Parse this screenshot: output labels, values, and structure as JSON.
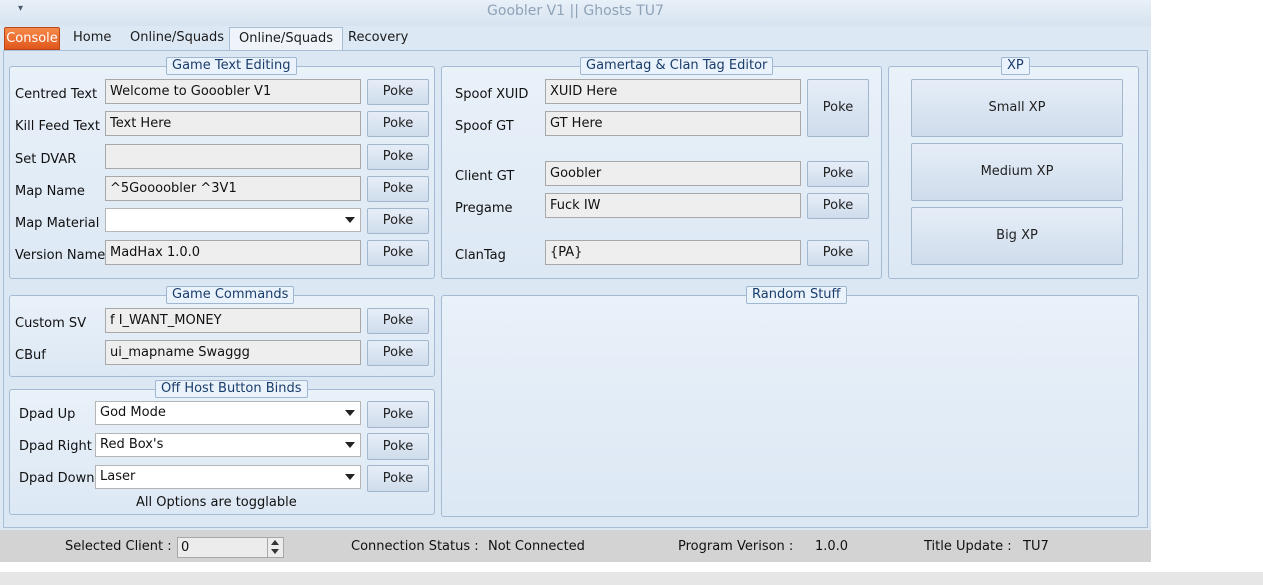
{
  "window": {
    "title": "Goobler V1 || Ghosts TU7",
    "quick_access": "▾"
  },
  "tabs": [
    {
      "label": "Console"
    },
    {
      "label": "Home"
    },
    {
      "label": "Online/Squads"
    },
    {
      "label": "Online/Squads"
    },
    {
      "label": "Recovery"
    }
  ],
  "game_text": {
    "title": "Game Text Editing",
    "rows": [
      {
        "label": "Centred Text",
        "value": "Welcome to Gooobler V1",
        "button": "Poke"
      },
      {
        "label": "Kill Feed Text",
        "value": "Text Here",
        "button": "Poke"
      },
      {
        "label": "Set DVAR",
        "value": "",
        "button": "Poke"
      },
      {
        "label": "Map Name",
        "value": "^5Goooobler ^3V1",
        "button": "Poke"
      },
      {
        "label": "Map Material",
        "value": "",
        "button": "Poke"
      },
      {
        "label": "Version Name",
        "value": "MadHax 1.0.0",
        "button": "Poke"
      }
    ]
  },
  "gamertag": {
    "title": "Gamertag & Clan Tag Editor",
    "spoof_xuid": {
      "label": "Spoof XUID",
      "value": "XUID Here"
    },
    "spoof_gt": {
      "label": "Spoof GT",
      "value": "GT Here"
    },
    "spoof_button": "Poke",
    "client_gt": {
      "label": "Client GT",
      "value": "Goobler",
      "button": "Poke"
    },
    "pregame": {
      "label": "Pregame",
      "value": "Fuck IW",
      "button": "Poke"
    },
    "clantag": {
      "label": "ClanTag",
      "value": "{PA}",
      "button": "Poke"
    }
  },
  "xp": {
    "title": "XP",
    "small": "Small XP",
    "medium": "Medium XP",
    "big": "Big XP"
  },
  "game_commands": {
    "title": "Game Commands",
    "custom_sv": {
      "label": "Custom SV",
      "value": "f I_WANT_MONEY",
      "button": "Poke"
    },
    "cbuf": {
      "label": "CBuf",
      "value": "ui_mapname Swaggg",
      "button": "Poke"
    }
  },
  "binds": {
    "title": "Off Host Button Binds",
    "rows": [
      {
        "label": "Dpad Up",
        "value": "God Mode",
        "button": "Poke"
      },
      {
        "label": "Dpad Right",
        "value": "Red Box's",
        "button": "Poke"
      },
      {
        "label": "Dpad Down",
        "value": "Laser",
        "button": "Poke"
      }
    ],
    "note": "All Options are togglable"
  },
  "random": {
    "title": "Random Stuff"
  },
  "status": {
    "selected_client_label": "Selected Client :",
    "selected_client_value": "0",
    "connection_label": "Connection Status :",
    "connection_value": "Not Connected",
    "version_label": "Program Verison :",
    "version_value": "1.0.0",
    "title_update_label": "Title Update :",
    "title_update_value": "TU7"
  }
}
